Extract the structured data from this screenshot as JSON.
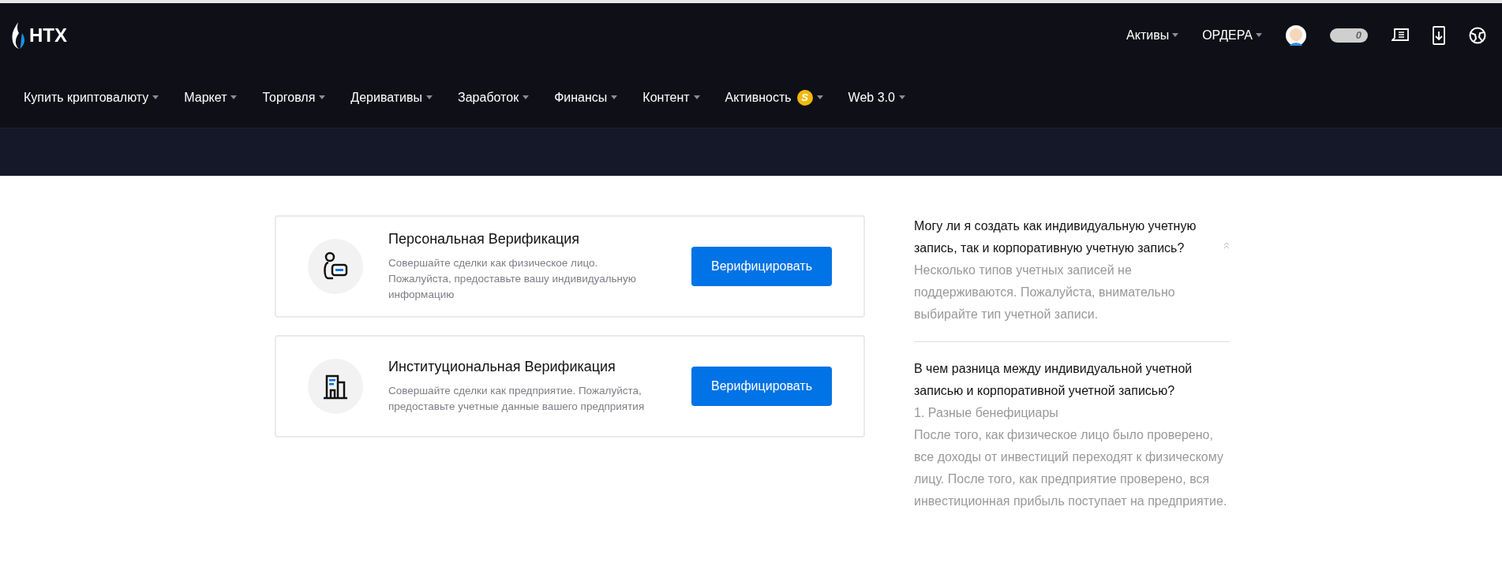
{
  "header": {
    "logo": "HTX",
    "right_menu": [
      {
        "label": "Активы"
      },
      {
        "label": "ОРДЕРА"
      }
    ],
    "pill_count": "0"
  },
  "nav": [
    {
      "label": "Купить криптовалюту"
    },
    {
      "label": "Маркет"
    },
    {
      "label": "Торговля"
    },
    {
      "label": "Деривативы"
    },
    {
      "label": "Заработок"
    },
    {
      "label": "Финансы"
    },
    {
      "label": "Контент"
    },
    {
      "label": "Активность",
      "badge": "S"
    },
    {
      "label": "Web 3.0"
    }
  ],
  "cards": [
    {
      "kind": "personal",
      "title": "Персональная Верификация",
      "description": "Совершайте сделки как физическое лицо. Пожалуйста, предоставьте вашу индивидуальную информацию",
      "button": "Верифицировать"
    },
    {
      "kind": "institutional",
      "title": "Институциональная Верификация",
      "description": "Совершайте сделки как предприятие. Пожалуйста, предоставьте учетные данные вашего предприятия",
      "button": "Верифицировать"
    }
  ],
  "faq": [
    {
      "question": "Могу ли я создать как индивидуальную учетную запись, так и корпоративную учетную запись?",
      "expanded": true,
      "answer": [
        "Несколько типов учетных записей не поддерживаются. Пожалуйста, внимательно выбирайте тип учетной записи."
      ]
    },
    {
      "question": "В чем разница между индивидуальной учетной записью и корпоративной учетной записью?",
      "answer": [
        "1. Разные бенефициары",
        "После того, как физическое лицо было проверено, все доходы от инвестиций переходят к физическому лицу. После того, как предприятие проверено, вся инвестиционная прибыль поступает на предприятие."
      ]
    }
  ]
}
